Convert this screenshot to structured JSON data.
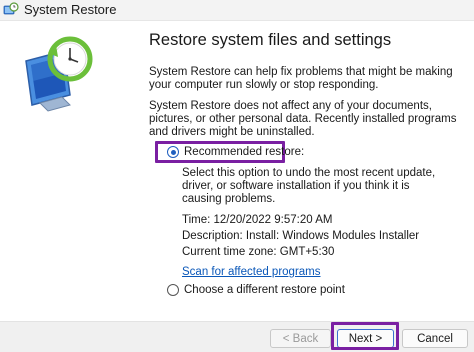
{
  "window": {
    "title": "System Restore"
  },
  "left_pane": {
    "icon": "system-restore-icon"
  },
  "main": {
    "heading": "Restore system files and settings",
    "paragraph1": "System Restore can help fix problems that might be making your computer run slowly or stop responding.",
    "paragraph2": "System Restore does not affect any of your documents, pictures, or other personal data. Recently installed programs and drivers might be uninstalled.",
    "recommended": {
      "label": "Recommended restore:",
      "selected": true,
      "description": "Select this option to undo the most recent update, driver, or software installation if you think it is causing problems.",
      "time": "Time: 12/20/2022 9:57:20 AM",
      "description_line": "Description: Install: Windows Modules Installer",
      "timezone": "Current time zone: GMT+5:30",
      "scan_link": "Scan for affected programs"
    },
    "different": {
      "label": "Choose a different restore point",
      "selected": false
    }
  },
  "footer": {
    "back_label": "< Back",
    "next_label": "Next >",
    "cancel_label": "Cancel"
  },
  "colors": {
    "highlight": "#7a1fa2",
    "link": "#0a57b8",
    "radio_selected": "#1f5fbf"
  }
}
